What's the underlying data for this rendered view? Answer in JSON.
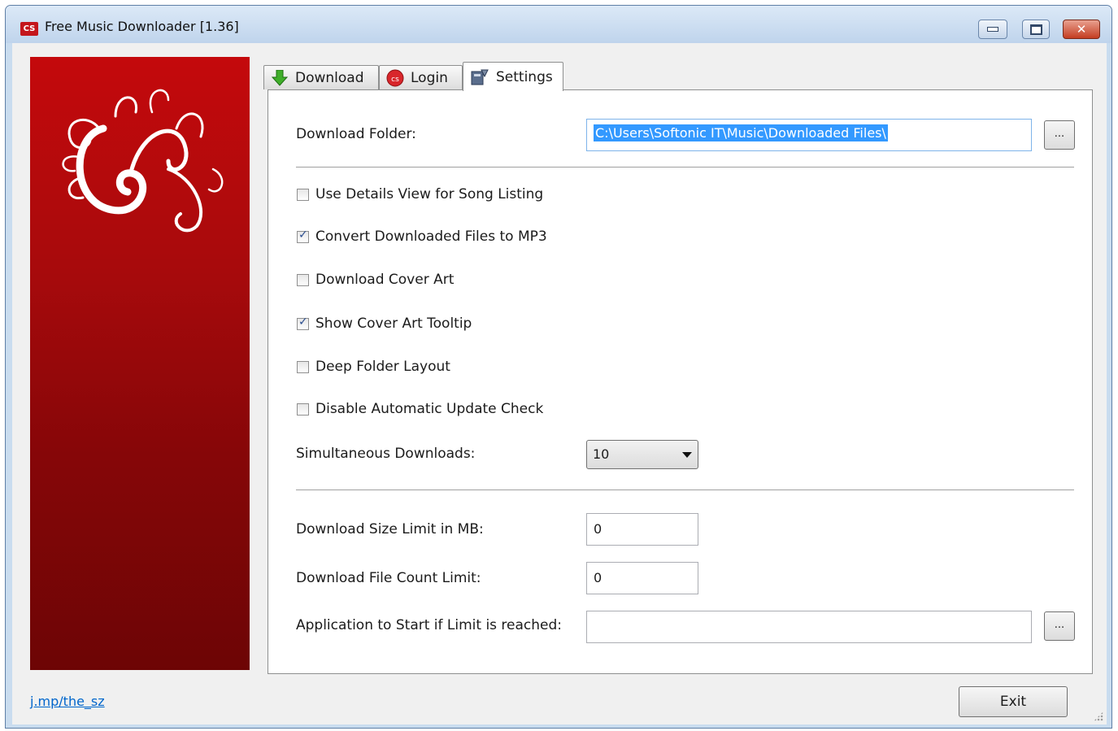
{
  "window": {
    "title": "Free Music Downloader [1.36]",
    "app_icon_text": "CS"
  },
  "tabs": [
    {
      "label": "Download",
      "icon": "download-arrow-icon"
    },
    {
      "label": "Login",
      "icon": "login-icon"
    },
    {
      "label": "Settings",
      "icon": "settings-icon",
      "selected": true
    }
  ],
  "settings": {
    "download_folder_label": "Download Folder:",
    "download_folder_value": "C:\\Users\\Softonic IT\\Music\\Downloaded Files\\",
    "browse_label": "...",
    "checkboxes": [
      {
        "label": "Use Details View for Song Listing",
        "checked": false
      },
      {
        "label": "Convert Downloaded Files to MP3",
        "checked": true
      },
      {
        "label": "Download Cover Art",
        "checked": false
      },
      {
        "label": "Show Cover Art Tooltip",
        "checked": true
      },
      {
        "label": "Deep Folder Layout",
        "checked": false
      },
      {
        "label": "Disable Automatic Update Check",
        "checked": false
      }
    ],
    "simultaneous_label": "Simultaneous Downloads:",
    "simultaneous_value": "10",
    "size_limit_label": "Download Size Limit in MB:",
    "size_limit_value": "0",
    "count_limit_label": "Download File Count Limit:",
    "count_limit_value": "0",
    "app_start_label": "Application to Start if Limit is reached:",
    "app_start_value": ""
  },
  "footer": {
    "link_text": "j.mp/the_sz",
    "exit_label": "Exit"
  },
  "colors": {
    "banner_top": "#c4090c",
    "banner_bottom": "#6d0505",
    "selection": "#3399ff",
    "link": "#0066cc"
  }
}
